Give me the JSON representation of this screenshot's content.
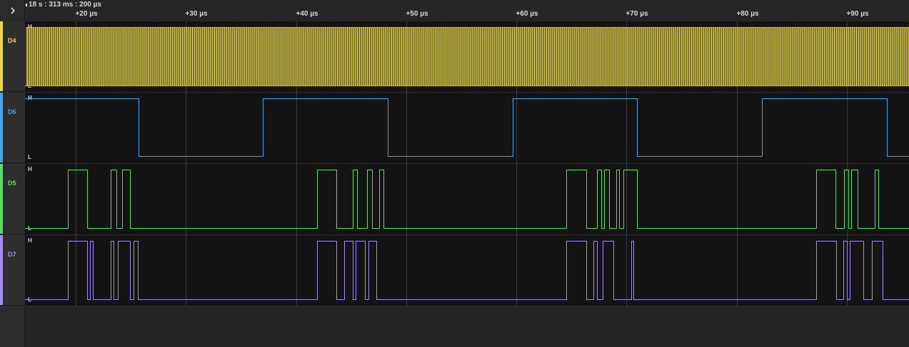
{
  "time_ruler": {
    "readout": "18 s : 313 ms : 200 µs",
    "ticks": [
      "+20 µs",
      "+30 µs",
      "+40 µs",
      "+50 µs",
      "+60 µs",
      "+70 µs",
      "+80 µs",
      "+90 µs"
    ]
  },
  "level_labels": {
    "high": "H",
    "low": "L"
  },
  "channels": [
    {
      "name": "D4",
      "color": "#e8d84a",
      "signal": "clock"
    },
    {
      "name": "D6",
      "color": "#4aa3e8",
      "signal": "square"
    },
    {
      "name": "D5",
      "color": "#5fd86a",
      "signal": "burst"
    },
    {
      "name": "D7",
      "color": "#a38cf0",
      "signal": "burst"
    }
  ],
  "icons": {
    "expand": "chevron-right-icon",
    "scroll_left": "triangle-left-icon"
  }
}
